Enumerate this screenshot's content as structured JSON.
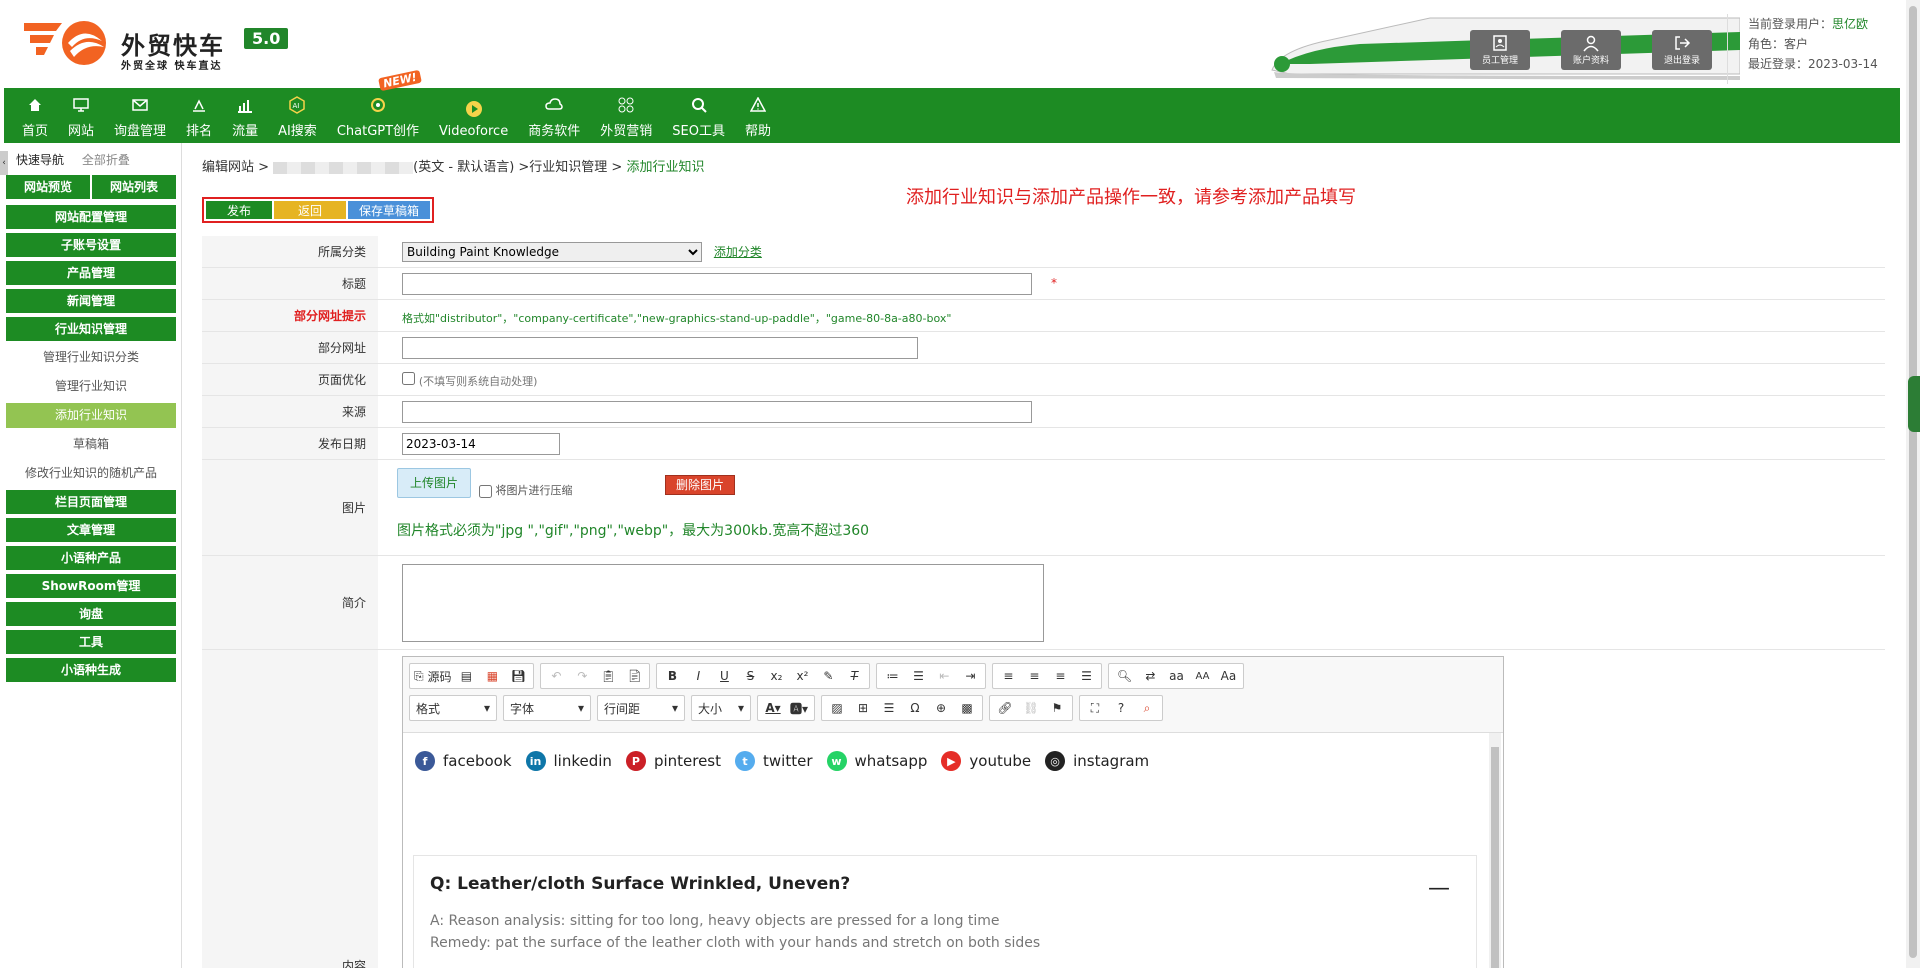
{
  "brand": {
    "name": "外贸快车",
    "version": "5.0",
    "tagline": "外贸全球 快车直达",
    "colors": {
      "primary_green": "#1d8b23",
      "accent_orange": "#f26322",
      "red": "#e02020"
    }
  },
  "header_buttons": [
    {
      "label": "员工管理",
      "icon": "staff-icon"
    },
    {
      "label": "账户资料",
      "icon": "account-icon"
    },
    {
      "label": "退出登录",
      "icon": "logout-icon"
    }
  ],
  "user": {
    "current_label": "当前登录用户：",
    "current_name": "思亿欧",
    "role_label": "角色：",
    "role": "客户",
    "last_login_label": "最近登录：",
    "last_login": "2023-03-14"
  },
  "nav": {
    "new_badge": "NEW!",
    "items": [
      {
        "label": "首页",
        "icon": "home-icon"
      },
      {
        "label": "网站",
        "icon": "monitor-icon"
      },
      {
        "label": "询盘管理",
        "icon": "mail-icon"
      },
      {
        "label": "排名",
        "icon": "ranking-icon"
      },
      {
        "label": "流量",
        "icon": "chart-icon"
      },
      {
        "label": "AI搜索",
        "icon": "ai-icon"
      },
      {
        "label": "ChatGPT创作",
        "icon": "chatgpt-icon"
      },
      {
        "label": "Videoforce",
        "icon": "video-icon"
      },
      {
        "label": "商务软件",
        "icon": "software-icon"
      },
      {
        "label": "外贸营销",
        "icon": "marketing-icon"
      },
      {
        "label": "SEO工具",
        "icon": "search-icon"
      },
      {
        "label": "帮助",
        "icon": "warning-icon"
      }
    ]
  },
  "sidebar": {
    "collapse_glyph": "‹",
    "quick_nav": "快速导航",
    "collapse_all": "全部折叠",
    "preview": "网站预览",
    "site_list": "网站列表",
    "menu": [
      {
        "label": "网站配置管理",
        "type": "group"
      },
      {
        "label": "子账号设置",
        "type": "group"
      },
      {
        "label": "产品管理",
        "type": "group"
      },
      {
        "label": "新闻管理",
        "type": "group"
      },
      {
        "label": "行业知识管理",
        "type": "group"
      },
      {
        "label": "管理行业知识分类",
        "type": "sub"
      },
      {
        "label": "管理行业知识",
        "type": "sub"
      },
      {
        "label": "添加行业知识",
        "type": "active"
      },
      {
        "label": "草稿箱",
        "type": "sub"
      },
      {
        "label": "修改行业知识的随机产品",
        "type": "sub"
      },
      {
        "label": "栏目页面管理",
        "type": "group"
      },
      {
        "label": "文章管理",
        "type": "group"
      },
      {
        "label": "小语种产品",
        "type": "group"
      },
      {
        "label": "ShowRoom管理",
        "type": "group"
      },
      {
        "label": "询盘",
        "type": "group"
      },
      {
        "label": "工具",
        "type": "group"
      },
      {
        "label": "小语种生成",
        "type": "group"
      }
    ]
  },
  "breadcrumb": {
    "prefix": "编辑网站 > ",
    "site_suffix": "(英文 - 默认语言) >行业知识管理 > ",
    "current": "添加行业知识"
  },
  "actions": {
    "publish": "发布",
    "back": "返回",
    "save_draft": "保存草稿箱"
  },
  "notice": "添加行业知识与添加产品操作一致，请参考添加产品填写",
  "form": {
    "category_label": "所属分类",
    "category_value": "Building Paint Knowledge",
    "add_category": "添加分类",
    "title_label": "标题",
    "title_value": "",
    "required_star": "*",
    "url_hint_label": "部分网址提示",
    "url_hint": "格式如\"distributor\"，\"company-certificate\",\"new-graphics-stand-up-paddle\"，\"game-80-8a-a80-box\"",
    "url_label": "部分网址",
    "url_value": "",
    "seo_label": "页面优化",
    "seo_note": "(不填写则系统自动处理)",
    "source_label": "来源",
    "source_value": "",
    "date_label": "发布日期",
    "date_value": "2023-03-14",
    "image_label": "图片",
    "upload_btn": "上传图片",
    "compress_label": "将图片进行压缩",
    "delete_btn": "删除图片",
    "image_hint": "图片格式必须为\"jpg \",\"gif\",\"png\",\"webp\"，最大为300kb.宽高不超过360",
    "intro_label": "简介",
    "intro_value": "",
    "content_label": "内容"
  },
  "editor": {
    "source_btn": "源码",
    "combos": [
      "格式",
      "字体",
      "行间距",
      "大小"
    ],
    "social": [
      {
        "label": "facebook",
        "glyph": "f",
        "color": "#3b5998"
      },
      {
        "label": "linkedin",
        "glyph": "in",
        "color": "#0e76a8"
      },
      {
        "label": "pinterest",
        "glyph": "P",
        "color": "#cb2027"
      },
      {
        "label": "twitter",
        "glyph": "t",
        "color": "#55acee"
      },
      {
        "label": "whatsapp",
        "glyph": "w",
        "color": "#25d366"
      },
      {
        "label": "youtube",
        "glyph": "▶",
        "color": "#e52d27"
      },
      {
        "label": "instagram",
        "glyph": "◎",
        "color": "#222222"
      }
    ],
    "faq_question": "Q: Leather/cloth Surface Wrinkled, Uneven?",
    "faq_answer_1": "A: Reason analysis: sitting for too long, heavy objects are pressed for a long time",
    "faq_answer_2": "Remedy: pat the surface of the leather cloth with your hands and stretch on both sides",
    "faq_toggle": "—"
  }
}
